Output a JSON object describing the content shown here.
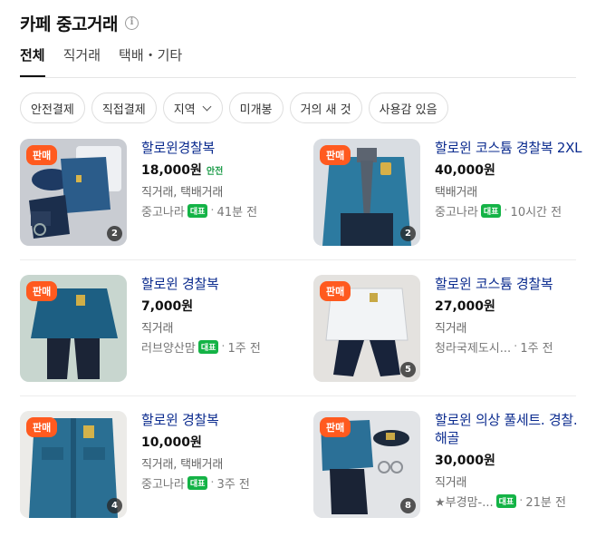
{
  "header": {
    "title": "카페 중고거래",
    "info_icon": "info-icon"
  },
  "tabs": [
    {
      "label": "전체",
      "active": true
    },
    {
      "label": "직거래",
      "active": false
    },
    {
      "label": "택배・기타",
      "active": false
    }
  ],
  "filters": [
    "안전결제",
    "직접결제",
    "지역",
    "미개봉",
    "거의 새 것",
    "사용감 있음"
  ],
  "colors": {
    "accent_badge": "#ff5a1f",
    "title_link": "#0c2c8f",
    "rep_badge": "#14b346",
    "safe_pay": "#1d9c4a"
  },
  "listings": [
    {
      "badge": "판매",
      "title": "할로윈경찰복",
      "price": "18,000원",
      "safe_pay": "안전",
      "method": "직거래, 택배거래",
      "cafe": "중고나라",
      "rep": "대표",
      "time": "41분 전",
      "photo_count": "2"
    },
    {
      "badge": "판매",
      "title": "할로윈 코스튬 경찰복 2XL",
      "price": "40,000원",
      "safe_pay": "",
      "method": "택배거래",
      "cafe": "중고나라",
      "rep": "대표",
      "time": "10시간 전",
      "photo_count": "2"
    },
    {
      "badge": "판매",
      "title": "할로윈 경찰복",
      "price": "7,000원",
      "safe_pay": "",
      "method": "직거래",
      "cafe": "러브양산맘",
      "rep": "대표",
      "time": "1주 전",
      "photo_count": ""
    },
    {
      "badge": "판매",
      "title": "할로윈 코스튬 경찰복",
      "price": "27,000원",
      "safe_pay": "",
      "method": "직거래",
      "cafe": "청라국제도시...",
      "rep": "",
      "time": "1주 전",
      "photo_count": "5"
    },
    {
      "badge": "판매",
      "title": "할로윈 경찰복",
      "price": "10,000원",
      "safe_pay": "",
      "method": "직거래, 택배거래",
      "cafe": "중고나라",
      "rep": "대표",
      "time": "3주 전",
      "photo_count": "4"
    },
    {
      "badge": "판매",
      "title": "할로윈 의상 풀세트. 경찰. 해골",
      "price": "30,000원",
      "safe_pay": "",
      "method": "직거래",
      "cafe": "★부경맘-...",
      "rep": "대표",
      "time": "21분 전",
      "photo_count": "8"
    }
  ]
}
